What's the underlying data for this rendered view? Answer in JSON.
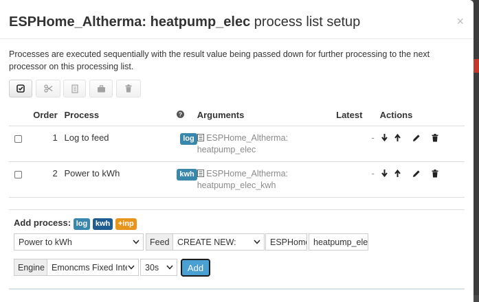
{
  "modal": {
    "title_bold": "ESPHome_Altherma: heatpump_elec",
    "title_rest": " process list setup",
    "close": "×",
    "description": "Processes are executed sequentially with the result value being passed down for further processing to the next processor on this processing list."
  },
  "table": {
    "headers": {
      "order": "Order",
      "process": "Process",
      "arguments": "Arguments",
      "latest": "Latest",
      "actions": "Actions"
    },
    "rows": [
      {
        "order": "1",
        "process": "Log to feed",
        "badge": "log",
        "arg_line1": "ESPHome_Altherma:",
        "arg_line2": "heatpump_elec",
        "latest": "-"
      },
      {
        "order": "2",
        "process": "Power to kWh",
        "badge": "kwh",
        "arg_line1": "ESPHome_Altherma:",
        "arg_line2": "heatpump_elec_kwh",
        "latest": "-"
      }
    ]
  },
  "add": {
    "label": "Add process:",
    "badges": [
      "log",
      "kwh",
      "+inp"
    ],
    "process_select": "Power to kWh",
    "feed_label": "Feed",
    "feed_select": "CREATE NEW:",
    "tag_value": "ESPHome_Altherma",
    "name_value": "heatpump_elec_kwh",
    "engine_label": "Engine",
    "engine_select": "Emoncms Fixed Interval",
    "interval_select": "30s",
    "add_button": "Add"
  },
  "colors": {
    "badge_blue": "#3a87ad",
    "badge_navy": "#1f5c8f",
    "badge_orange": "#e8961b",
    "add_button": "#4a9fd3"
  },
  "icons": [
    "check-icon",
    "scissors-icon",
    "copy-icon",
    "briefcase-icon",
    "trash-icon",
    "question-icon",
    "feed-icon",
    "arrow-down-icon",
    "arrow-up-icon",
    "pencil-icon",
    "trash-icon"
  ]
}
